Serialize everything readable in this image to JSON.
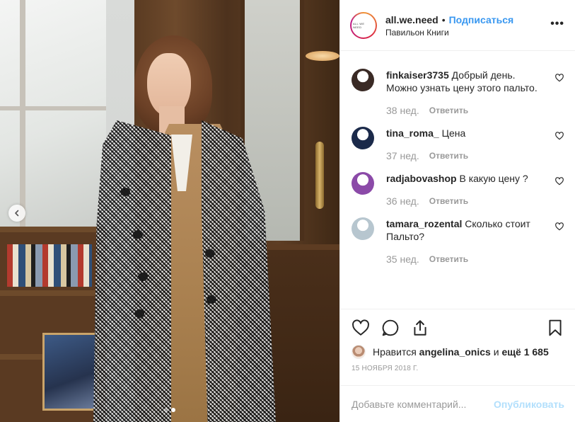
{
  "header": {
    "avatar_text": "ALL WE NEED",
    "username": "all.we.need",
    "bullet": "•",
    "follow_label": "Подписаться",
    "location": "Павильон Книги",
    "more_label": "•••"
  },
  "comments": [
    {
      "user": "finkaiser3735",
      "text": "Добрый день. Можно узнать цену этого пальто.",
      "age": "38 нед.",
      "reply": "Ответить",
      "avatar_color": "#3a2a25"
    },
    {
      "user": "tina_roma_",
      "text": "Цена",
      "age": "37 нед.",
      "reply": "Ответить",
      "avatar_color": "#1b2a4a"
    },
    {
      "user": "radjabovashop",
      "text": "В какую цену ?",
      "age": "36 нед.",
      "reply": "Ответить",
      "avatar_color": "#8b4aa8"
    },
    {
      "user": "tamara_rozental",
      "text": "Сколько стоит Пальто?",
      "age": "35 нед.",
      "reply": "Ответить",
      "avatar_color": "#b7c6cf"
    }
  ],
  "likes": {
    "prefix": "Нравится",
    "user": "angelina_onics",
    "conj": "и",
    "more": "ещё 1 685"
  },
  "date": "15 ноября 2018 г.",
  "add_comment": {
    "placeholder": "Добавьте комментарий...",
    "publish_label": "Опубликовать"
  },
  "colors": {
    "accent": "#3897f0",
    "publish_disabled": "#b2dffc",
    "meta": "#999999"
  },
  "carousel": {
    "slide": 2,
    "total": 2
  }
}
